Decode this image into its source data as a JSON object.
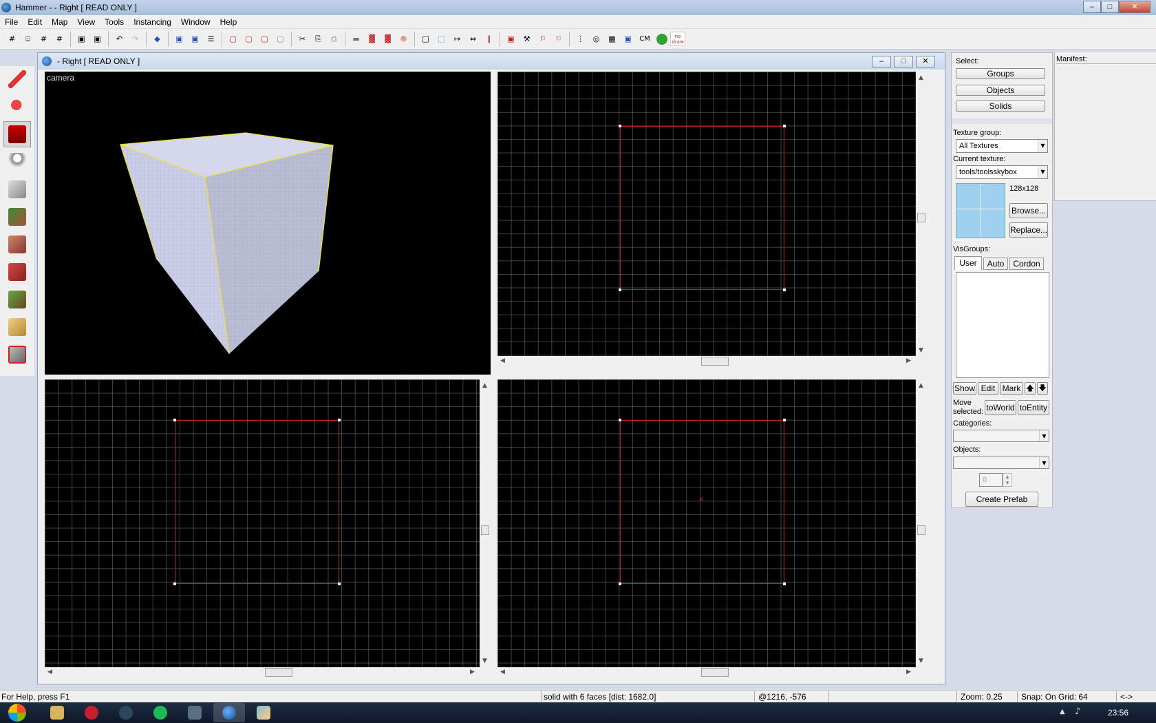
{
  "window": {
    "title": "Hammer -  - Right [ READ ONLY ]",
    "min": "–",
    "max": "□",
    "close": "✕"
  },
  "menu": [
    "File",
    "Edit",
    "Map",
    "View",
    "Tools",
    "Instancing",
    "Window",
    "Help"
  ],
  "toolbar": {
    "items": [
      "#",
      "⌸",
      "#",
      "#",
      "▣",
      "▣",
      "↶",
      "↷",
      "◆",
      "▣",
      "▣",
      "☰",
      "▢",
      "▢",
      "▢",
      "▢",
      "✂",
      "⎘",
      "⎙",
      "▬",
      "▓",
      "▓",
      "®",
      "□",
      "⬚",
      "↦",
      "⇔",
      "∥",
      "▣",
      "⚒",
      "⚐",
      "⚐",
      "⋮",
      "◎",
      "▦",
      "▣"
    ],
    "cm_label": "CM",
    "nodraw_label": "no draw"
  },
  "doc": {
    "title": " - Right [ READ ONLY ]",
    "camera_label": "camera"
  },
  "panel": {
    "select_label": "Select:",
    "groups": "Groups",
    "objects": "Objects",
    "solids": "Solids",
    "texture_group_label": "Texture group:",
    "texture_group_value": "All Textures",
    "current_texture_label": "Current texture:",
    "current_texture_value": "tools/toolsskybox",
    "texture_size": "128x128",
    "browse": "Browse...",
    "replace": "Replace...",
    "visgroups_label": "VisGroups:",
    "tabs": [
      "User",
      "Auto",
      "Cordon"
    ],
    "show": "Show",
    "edit": "Edit",
    "mark": "Mark",
    "up": "🡅",
    "down": "🡇",
    "move_selected": "Move\nselected:",
    "to_world": "toWorld",
    "to_entity": "toEntity",
    "categories_label": "Categories:",
    "objects_label": "Objects:",
    "spinner_value": "0",
    "create_prefab": "Create Prefab"
  },
  "manifest": {
    "label": "Manifest:"
  },
  "status": {
    "help": "For Help, press F1",
    "selection": "solid with 6 faces   [dist: 1682.0]",
    "coords": "@1216, -576",
    "zoom": "Zoom: 0.25",
    "snap": "Snap: On Grid: 64",
    "arrows": "<->"
  },
  "taskbar": {
    "clock": "23:56"
  },
  "colors": {
    "brush_outline": "#c02020",
    "selection_edge": "#f0e040",
    "skybox": "#c9cde6"
  }
}
